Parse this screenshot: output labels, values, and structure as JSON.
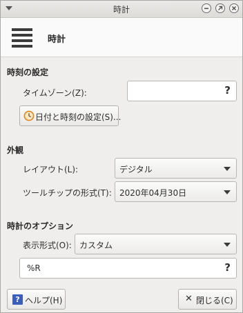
{
  "window": {
    "title": "時計"
  },
  "header": {
    "title": "時計"
  },
  "sections": {
    "time": {
      "title": "時刻の設定"
    },
    "appearance": {
      "title": "外観"
    },
    "options": {
      "title": "時計のオプション"
    }
  },
  "timezone": {
    "label": "タイムゾーン(Z):",
    "value": "",
    "help_glyph": "?"
  },
  "datetime_button": {
    "label": "日付と時刻の設定(S)..."
  },
  "layout": {
    "label": "レイアウト(L):",
    "selected": "デジタル"
  },
  "tooltip_format": {
    "label": "ツールチップの形式(T):",
    "selected": "2020年04月30日"
  },
  "display_format": {
    "label": "表示形式(O):",
    "selected": "カスタム"
  },
  "custom_format": {
    "value": "%R",
    "help_glyph": "?"
  },
  "footer": {
    "help_label": "ヘルプ(H)",
    "help_glyph": "?",
    "close_label": "閉じる(C)",
    "close_glyph": "✕"
  },
  "colors": {
    "help_icon_bg": "#3a5dbe",
    "clock_icon": "#e0861f"
  }
}
